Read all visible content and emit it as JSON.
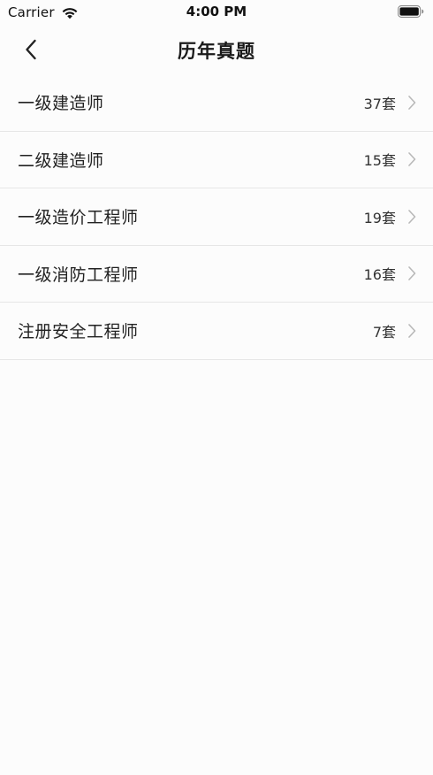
{
  "status_bar": {
    "carrier": "Carrier",
    "time": "4:00 PM",
    "icons": [
      "wifi-icon",
      "battery-icon"
    ]
  },
  "nav": {
    "title": "历年真题",
    "back_icon": "chevron-left-icon"
  },
  "list": {
    "items": [
      {
        "title": "一级建造师",
        "count": "37套"
      },
      {
        "title": "二级建造师",
        "count": "15套"
      },
      {
        "title": "一级造价工程师",
        "count": "19套"
      },
      {
        "title": "一级消防工程师",
        "count": "16套"
      },
      {
        "title": "注册安全工程师",
        "count": "7套"
      }
    ],
    "row_icon": "chevron-right-icon"
  },
  "colors": {
    "background": "#fcfcfc",
    "divider": "#e6e6e6",
    "chevron": "#b8b8b8",
    "text": "#222222"
  }
}
